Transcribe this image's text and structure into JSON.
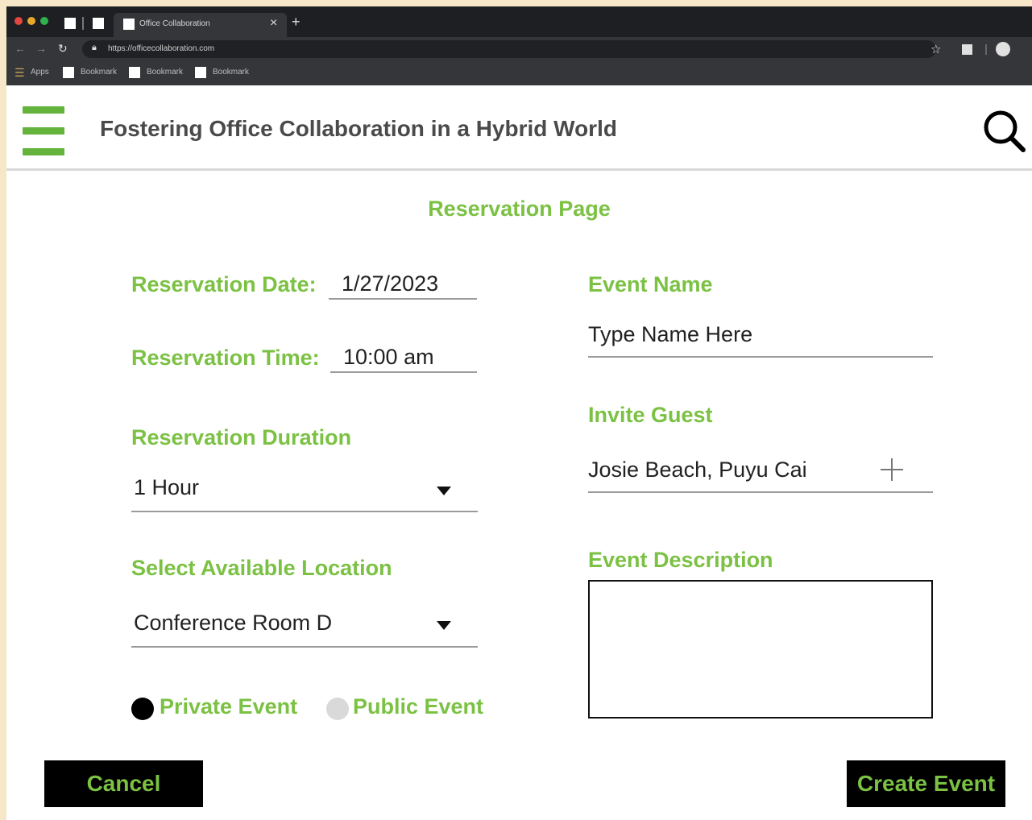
{
  "browser": {
    "tab_title": "Office Collaboration",
    "tab_close": "×",
    "new_tab": "+",
    "url": "https://officecollaboration.com",
    "bookmarks": {
      "apps": "Apps",
      "items": [
        "Bookmark",
        "Bookmark",
        "Bookmark"
      ]
    }
  },
  "header": {
    "title": "Fostering Office Collaboration in a Hybrid World"
  },
  "page": {
    "heading": "Reservation Page"
  },
  "form": {
    "date": {
      "label": "Reservation Date:",
      "value": "1/27/2023"
    },
    "time": {
      "label": "Reservation Time:",
      "value": "10:00 am"
    },
    "duration": {
      "label": "Reservation Duration",
      "value": "1 Hour"
    },
    "location": {
      "label": "Select Available Location",
      "value": "Conference Room D"
    },
    "event_name": {
      "label": "Event Name",
      "placeholder": "Type Name Here"
    },
    "invite": {
      "label": "Invite Guest",
      "value": "Josie Beach, Puyu Cai"
    },
    "description": {
      "label": "Event Description",
      "value": ""
    },
    "privacy": {
      "private_label": "Private Event",
      "public_label": "Public Event",
      "selected": "private"
    }
  },
  "buttons": {
    "cancel": "Cancel",
    "create": "Create Event"
  },
  "colors": {
    "accent": "#7bc143",
    "menu": "#63b33d",
    "button_bg": "#000000",
    "radio_inactive": "#d9d9d9"
  }
}
